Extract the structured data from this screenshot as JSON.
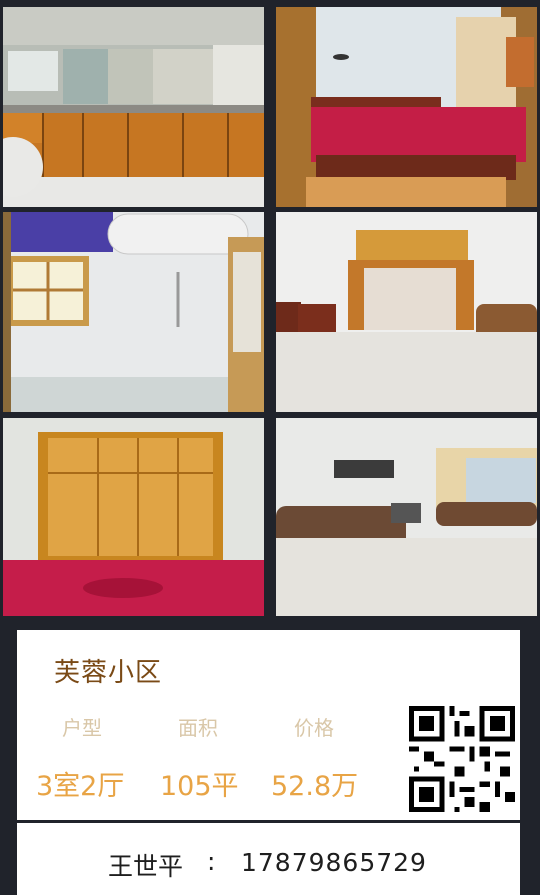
{
  "listing": {
    "community": "芙蓉小区",
    "labels": {
      "layout": "户型",
      "area": "面积",
      "price": "价格"
    },
    "values": {
      "layout": "3室2厅",
      "area": "105平",
      "price": "52.8万"
    }
  },
  "contact": {
    "name": "王世平",
    "separator": ":",
    "phone": "17879865729"
  },
  "photos": [
    {
      "icon": "kitchen-photo"
    },
    {
      "icon": "bedroom-photo"
    },
    {
      "icon": "bathroom-photo"
    },
    {
      "icon": "dining-room-photo"
    },
    {
      "icon": "wardrobe-bedroom-photo"
    },
    {
      "icon": "living-room-photo"
    }
  ],
  "colors": {
    "background": "#20232b",
    "title": "#7a4a16",
    "label": "#d9c7a8",
    "value": "#e8a445"
  }
}
